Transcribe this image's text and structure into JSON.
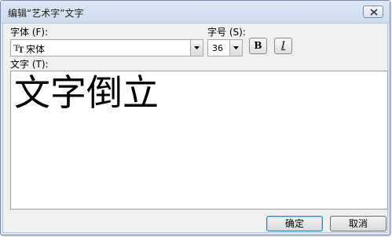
{
  "window": {
    "title": "编辑“艺术字”文字"
  },
  "font": {
    "label": "字体 (F):",
    "value": "宋体",
    "icon": "truetype-font-icon"
  },
  "size": {
    "label": "字号 (S):",
    "value": "36"
  },
  "style": {
    "bold_label": "B",
    "italic_label": "I"
  },
  "text": {
    "label": "文字 (T):",
    "value": "文字倒立"
  },
  "buttons": {
    "ok": "确定",
    "cancel": "取消"
  }
}
